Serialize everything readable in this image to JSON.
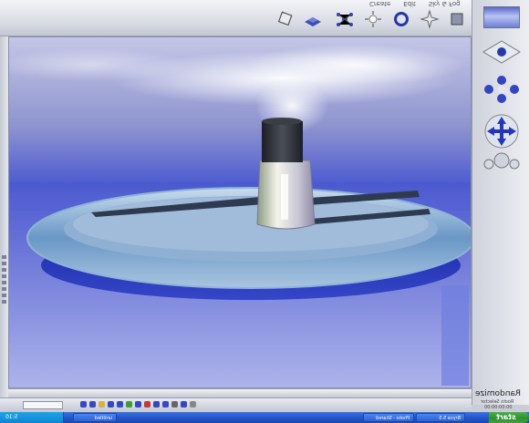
{
  "menus": {
    "items": [
      "Create",
      "Edit",
      "Sky & Fog"
    ]
  },
  "toolbar": {
    "tools": [
      "render-preview-tool",
      "object-tool",
      "group-tool",
      "sun-tool",
      "transform-tool",
      "rotate-tool",
      "cube-tool",
      "terrain-tool"
    ]
  },
  "panel": {
    "randomize_label": "Randomize",
    "sub_label": "Roots Selector",
    "time_label": "00:00:00:00"
  },
  "statusbar": {
    "frame_value": ""
  },
  "taskbar": {
    "start_label": "start",
    "clock": "5:10",
    "tasks": [
      {
        "label": "Bryce 5.5"
      },
      {
        "label": "Photo - Shared"
      },
      {
        "label": "untitled"
      }
    ]
  },
  "colors": {
    "sky_top": "#9fa4d6",
    "sky_horizon": "#2c3fd0",
    "ring_glass": "#6f9fcf",
    "ring_shadow": "#1f2da3",
    "cap": "#2e3238",
    "taskbar_blue": "#2456c9",
    "start_green": "#3a9d3a"
  }
}
